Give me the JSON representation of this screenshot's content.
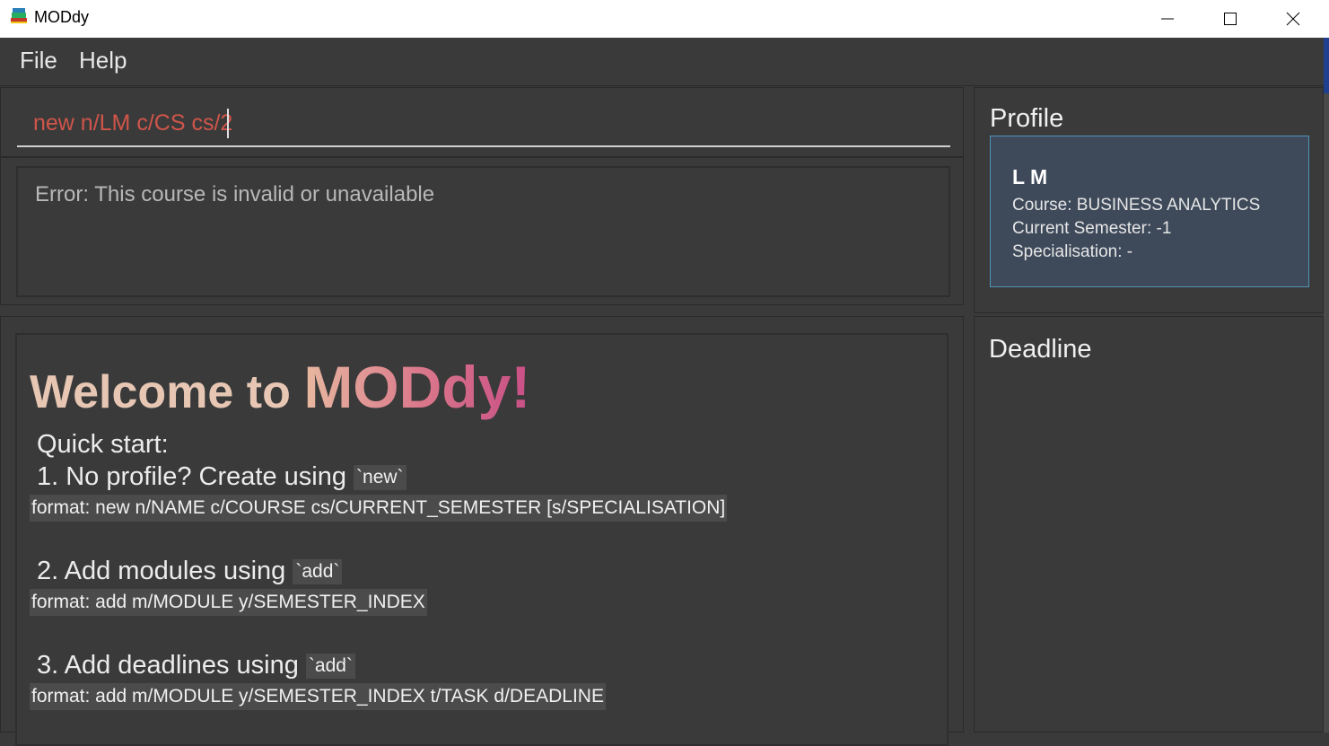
{
  "window": {
    "title": "MODdy",
    "app_icon": "books-icon",
    "controls": [
      "minimize-icon",
      "maximize-icon",
      "close-icon"
    ]
  },
  "menu": {
    "file_label": "File",
    "help_label": "Help"
  },
  "command": {
    "value": "new n/LM c/CS cs/2"
  },
  "result": {
    "message": "Error: This course is invalid or unavailable"
  },
  "welcome": {
    "prefix": "Welcome to ",
    "brand": "MODdy!",
    "quick_start": "Quick start:",
    "steps": [
      {
        "text": "1. No profile? Create using ",
        "code": "`new`",
        "format": "format: new n/NAME c/COURSE cs/CURRENT_SEMESTER [s/SPECIALISATION]"
      },
      {
        "text": "2. Add modules using ",
        "code": "`add`",
        "format": "format: add m/MODULE y/SEMESTER_INDEX"
      },
      {
        "text": "3. Add deadlines using ",
        "code": "`add`",
        "format": "format: add m/MODULE y/SEMESTER_INDEX t/TASK d/DEADLINE"
      }
    ]
  },
  "profile": {
    "title": "Profile",
    "name": "L M",
    "course": "Course: BUSINESS ANALYTICS",
    "semester": "Current Semester: -1",
    "specialisation": "Specialisation: -"
  },
  "deadline": {
    "title": "Deadline"
  },
  "colors": {
    "background": "#3a3a3a",
    "command_text": "#d0554a",
    "profile_card": "#3e4a5a",
    "profile_border": "#4f93b8",
    "brand_gradient_start": "#e8b8a0",
    "brand_gradient_end": "#c84f86"
  }
}
